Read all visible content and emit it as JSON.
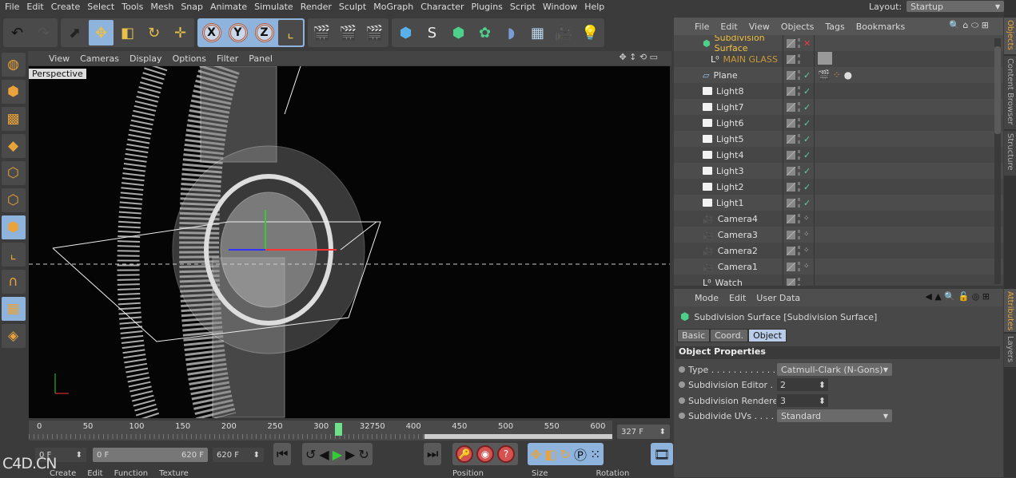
{
  "menu": [
    "File",
    "Edit",
    "Create",
    "Select",
    "Tools",
    "Mesh",
    "Snap",
    "Animate",
    "Simulate",
    "Render",
    "Sculpt",
    "MoGraph",
    "Character",
    "Plugins",
    "Script",
    "Window",
    "Help"
  ],
  "layout": {
    "label": "Layout:",
    "value": "Startup"
  },
  "axes": [
    "X",
    "Y",
    "Z"
  ],
  "viewport": {
    "menu": [
      "View",
      "Cameras",
      "Display",
      "Options",
      "Filter",
      "Panel"
    ],
    "label": "Perspective"
  },
  "timeline": {
    "ticks": [
      "0",
      "50",
      "100",
      "150",
      "200",
      "250",
      "300",
      "32750",
      "400",
      "450",
      "500",
      "550",
      "600"
    ],
    "current_frame": "327 F",
    "current_fraction": 0.527
  },
  "range": {
    "start": "0 F",
    "slider_start": "0 F",
    "slider_end": "620 F",
    "end": "620 F"
  },
  "watermark": "C4D.CN",
  "bottom_panels": {
    "left": [
      "Create",
      "Edit",
      "Function",
      "Texture"
    ],
    "right": [
      "Position",
      "Size",
      "Rotation"
    ]
  },
  "objects": {
    "menu": [
      "File",
      "Edit",
      "View",
      "Objects",
      "Tags",
      "Bookmarks"
    ],
    "items": [
      {
        "name": "Subdivision Surface",
        "color": "#f0c040",
        "icon": "subdivision-surface-icon",
        "status": "x"
      },
      {
        "name": "MAIN GLASS",
        "color": "#c89a3a",
        "icon": "null-icon",
        "status": ""
      },
      {
        "name": "Plane",
        "color": "#e0e0e0",
        "icon": "plane-icon",
        "status": "check"
      },
      {
        "name": "Light8",
        "color": "#e0e0e0",
        "icon": "light-icon",
        "status": "check"
      },
      {
        "name": "Light7",
        "color": "#e0e0e0",
        "icon": "light-icon",
        "status": "check"
      },
      {
        "name": "Light6",
        "color": "#e0e0e0",
        "icon": "light-icon",
        "status": "check"
      },
      {
        "name": "Light5",
        "color": "#e0e0e0",
        "icon": "light-icon",
        "status": "check"
      },
      {
        "name": "Light4",
        "color": "#e0e0e0",
        "icon": "light-icon",
        "status": "check"
      },
      {
        "name": "Light3",
        "color": "#e0e0e0",
        "icon": "light-icon",
        "status": "check"
      },
      {
        "name": "Light2",
        "color": "#e0e0e0",
        "icon": "light-icon",
        "status": "check"
      },
      {
        "name": "Light1",
        "color": "#e0e0e0",
        "icon": "light-icon",
        "status": "check"
      },
      {
        "name": "Camera4",
        "color": "#e0e0e0",
        "icon": "camera-icon",
        "status": "target"
      },
      {
        "name": "Camera3",
        "color": "#e0e0e0",
        "icon": "camera-icon",
        "status": "target"
      },
      {
        "name": "Camera2",
        "color": "#e0e0e0",
        "icon": "camera-icon",
        "status": "target"
      },
      {
        "name": "Camera1",
        "color": "#e0e0e0",
        "icon": "camera-icon",
        "status": "target"
      },
      {
        "name": "Watch",
        "color": "#e0e0e0",
        "icon": "null-icon",
        "status": ""
      }
    ]
  },
  "side_tabs": [
    "Objects",
    "Content Browser",
    "Structure",
    "Attributes",
    "Layers"
  ],
  "attributes": {
    "menu": [
      "Mode",
      "Edit",
      "User Data"
    ],
    "title": "Subdivision Surface [Subdivision Surface]",
    "tabs": [
      "Basic",
      "Coord.",
      "Object"
    ],
    "active_tab": "Object",
    "section": "Object Properties",
    "props": [
      {
        "label": "Type . . . . . . . . . . . . . . .",
        "value": "Catmull-Clark (N-Gons)",
        "kind": "dropdown"
      },
      {
        "label": "Subdivision Editor . . . .",
        "value": "2",
        "kind": "number"
      },
      {
        "label": "Subdivision Renderer",
        "value": "3",
        "kind": "number"
      },
      {
        "label": "Subdivide UVs . . . . . . .",
        "value": "Standard",
        "kind": "dropdown"
      }
    ]
  }
}
